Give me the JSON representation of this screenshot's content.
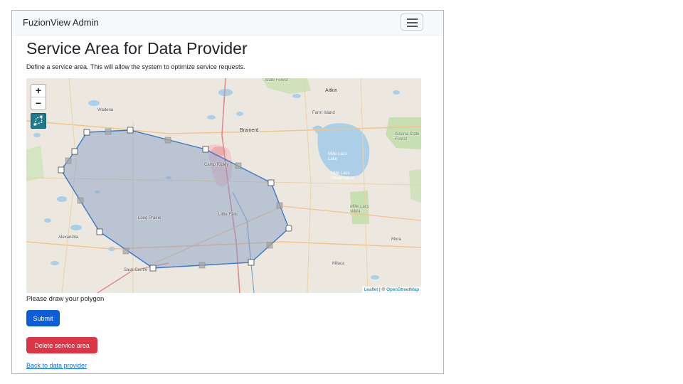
{
  "navbar": {
    "brand": "FuzionView Admin",
    "menu_icon": "hamburger-icon"
  },
  "page": {
    "title": "Service Area for Data Provider",
    "lead": "Define a service area. This will allow the system to optimize service requests.",
    "hint": "Please draw your polygon"
  },
  "map": {
    "zoom_in": "+",
    "zoom_out": "−",
    "draw_icon": "polygon-draw-icon",
    "attribution_leaflet": "Leaflet",
    "attribution_sep": " | © ",
    "attribution_osm": "OpenStreetMap",
    "labels": {
      "state_forest": "State Forest",
      "aitkin": "Aitkin",
      "wadena": "Wadena",
      "farm_island": "Farm Island",
      "brainerd": "Brainerd",
      "solana": "Solana State Forest",
      "mille_lacs_lake": "Mille Lacs Lake",
      "camp_ripley": "Camp Ripley",
      "mille_lacs_reservation": "Mille Lacs Reservation",
      "mille_lacs_wma": "Mille Lacs WMA",
      "long_prairie": "Long Prairie",
      "little_falls": "Little Falls",
      "alexandria": "Alexandria",
      "mora": "Mora",
      "sauk_centre": "Sauk Centre",
      "milaca": "Milaca"
    },
    "colors": {
      "polygon_stroke": "#3a78c2",
      "polygon_fill": "#7f9ac4",
      "lake": "#a8cde3",
      "forest": "#c8dfb1"
    }
  },
  "buttons": {
    "submit": "Submit",
    "delete": "Delete service area"
  },
  "links": {
    "back": "Back to data provider"
  },
  "colors": {
    "primary": "#0b5ed7",
    "danger": "#dc3545",
    "link": "#0d6efd"
  }
}
